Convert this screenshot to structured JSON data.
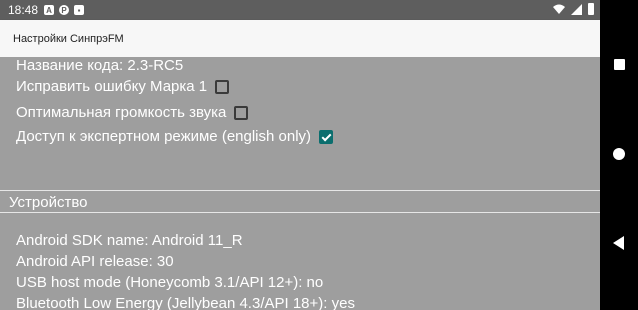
{
  "status_bar": {
    "time": "18:48",
    "notification_icons": [
      "A",
      "P",
      "▪"
    ]
  },
  "app_bar": {
    "title": "Настройки СинпрэFM"
  },
  "settings": {
    "code_name": "Название кода: 2.3-RC5",
    "fix_mark1": {
      "label": "Исправить ошибку Марка 1",
      "checked": false
    },
    "optimal_volume": {
      "label": "Оптимальная громкость звука",
      "checked": false
    },
    "expert_mode": {
      "label": "Доступ к экспертном режиме (english only)",
      "checked": true
    }
  },
  "device": {
    "header": "Устройство",
    "sdk_name": "Android SDK name: Android 11_R",
    "api_release": "Android API release: 30",
    "usb_host": "USB host mode (Honeycomb 3.1/API 12+): no",
    "ble": "Bluetooth Low Energy (Jellybean 4.3/API 18+): yes"
  },
  "colors": {
    "content_bg": "#9e9e9e",
    "status_bar_bg": "#5e5e5e",
    "app_bar_bg": "#f7f7f7",
    "accent": "#0b6e6e"
  },
  "icons": {
    "nav": [
      "recents-square-icon",
      "home-circle-icon",
      "back-triangle-icon"
    ],
    "status": [
      "wifi-icon",
      "signal-icon",
      "battery-icon"
    ]
  }
}
